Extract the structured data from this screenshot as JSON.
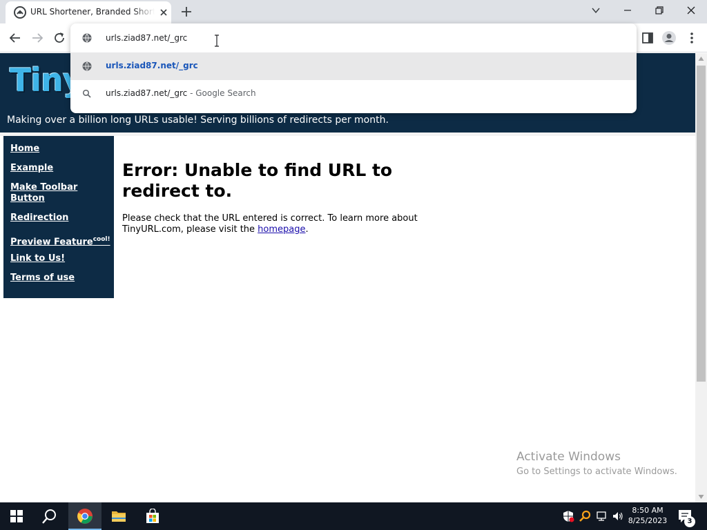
{
  "browser": {
    "tab_title": "URL Shortener, Branded Short Links & Analytics | TinyURL",
    "address_value": "urls.ziad87.net/_grc",
    "suggestions": [
      {
        "text": "urls.ziad87.net/_grc",
        "subtext": ""
      },
      {
        "text": "urls.ziad87.net/_grc",
        "subtext": " - Google Search"
      }
    ]
  },
  "page": {
    "logo_text": "TinyU",
    "tagline": "Making over a billion long URLs usable! Serving billions of redirects per month.",
    "nav": [
      {
        "label": "Home"
      },
      {
        "label": "Example"
      },
      {
        "label": "Make Toolbar Button"
      },
      {
        "label": "Redirection"
      },
      {
        "label": "Preview Feature",
        "sup": "cool!"
      },
      {
        "label": "Link to Us!"
      },
      {
        "label": "Terms of use"
      }
    ],
    "error_title": "Error: Unable to find URL to redirect to.",
    "error_msg_before": "Please check that the URL entered is correct. To learn more about TinyURL.com, please visit the ",
    "error_link": "homepage",
    "error_msg_after": "."
  },
  "watermark": {
    "line1": "Activate Windows",
    "line2": "Go to Settings to activate Windows."
  },
  "taskbar": {
    "time": "8:50 AM",
    "date": "8/25/2023",
    "notification_count": "3"
  },
  "colors": {
    "banner_bg": "#0d2b45",
    "suggestion_accent": "#1a56b9",
    "taskbar_bg": "#101722"
  }
}
